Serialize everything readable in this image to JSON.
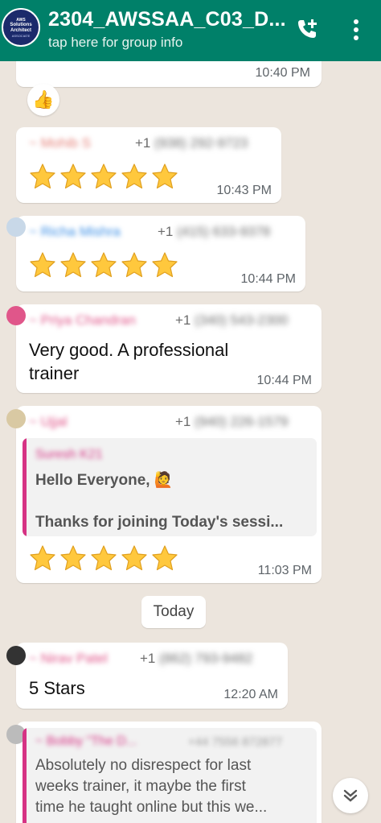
{
  "header": {
    "title": "2304_AWSSAA_C03_D...",
    "subtitle": "tap here for group info",
    "avatar": {
      "top": "AWS",
      "mid": "Solutions Architect",
      "bot": "ASSOCIATE"
    }
  },
  "messages": [
    {
      "time": "10:40 PM",
      "reaction": "👍"
    },
    {
      "sender": "~ Mohib S",
      "phone_prefix": "+1",
      "phone_rest": "(938) 292-9723",
      "stars": 5,
      "time": "10:43 PM"
    },
    {
      "sender": "~ Richa Mishra",
      "phone_prefix": "+1",
      "phone_rest": "(415) 633-9378",
      "stars": 5,
      "time": "10:44 PM"
    },
    {
      "sender": "~ Priya Chandran",
      "phone_prefix": "+1",
      "phone_rest": "(340) 543-2300",
      "text_line1": "Very good. A professional",
      "text_line2": "trainer",
      "time": "10:44 PM"
    },
    {
      "sender": "~ Ujjal",
      "phone_prefix": "+1",
      "phone_rest": "(940) 226-1579",
      "quote_author": "Suresh K21",
      "quote_line1": "Hello Everyone, 🙋",
      "quote_line2": "Thanks for joining Today's sessi...",
      "stars": 5,
      "time": "11:03 PM"
    },
    {
      "sender": "~ Nirav Patel",
      "phone_prefix": "+1",
      "phone_rest": "(862) 793-9482",
      "text": "5 Stars",
      "time": "12:20 AM"
    },
    {
      "quote_author": "~ Bobby \"The D...",
      "quote_phone": "+44 7556 872877",
      "quote_line1": "Absolutely no disrespect for last",
      "quote_line2": "weeks trainer, it maybe the first",
      "quote_line3": "time he taught online but this we..."
    }
  ],
  "date_divider": "Today",
  "colors": {
    "header_bg": "#008069",
    "chat_bg": "#ece5dd",
    "sender1": "#e5837b",
    "sender2": "#3a8ee6",
    "sender3": "#e0568a",
    "sender4": "#e0568a",
    "sender5": "#e0568a",
    "quote_bar": "#d63384"
  },
  "icons": {
    "call": "add-call-icon",
    "more": "more-vert-icon",
    "scroll": "chevron-double-down-icon",
    "star": "star-emoji"
  }
}
